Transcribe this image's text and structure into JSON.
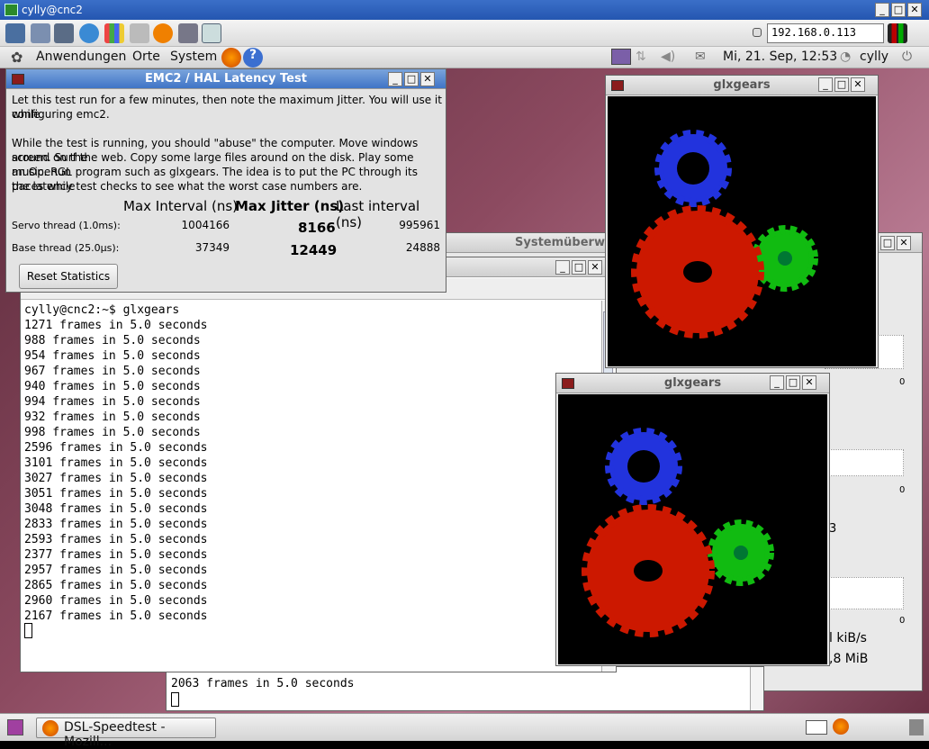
{
  "window": {
    "title": "cylly@cnc2"
  },
  "toolbar": {
    "ip": "192.168.0.113"
  },
  "panel": {
    "menu_apps": "Anwendungen",
    "menu_places": "Orte",
    "menu_system": "System",
    "clock": "Mi, 21. Sep, 12:53",
    "user": "cylly"
  },
  "emc": {
    "title": "EMC2 / HAL Latency Test",
    "intro1": "Let this test run for a few minutes, then note the maximum Jitter.  You will use it while",
    "intro2": "configuring emc2.",
    "body1": "While the test is running, you should \"abuse\" the computer. Move windows around on the",
    "body2": "screen. Surf the web. Copy some large files around on the disk. Play some music. Run",
    "body3": "an OpenGL program such as glxgears. The idea is to put the PC through its paces while",
    "body4": "the latency test checks to see what the worst case numbers are.",
    "col_max_interval": "Max Interval (ns)",
    "col_max_jitter": "Max Jitter (ns)",
    "col_last_interval": "Last interval (ns)",
    "servo_label": "Servo thread (1.0ms):",
    "servo_max_interval": "1004166",
    "servo_max_jitter": "8166",
    "servo_last_interval": "995961",
    "base_label": "Base thread (25.0µs):",
    "base_max_interval": "37349",
    "base_max_jitter": "12449",
    "base_last_interval": "24888",
    "reset_button": "Reset Statistics"
  },
  "sysmon": {
    "title": "Systemüberw",
    "rate": "l kiB/s",
    "mem": ",8 MiB",
    "axis_zero": "0",
    "partial_digit": "3"
  },
  "glx1": {
    "title": "glxgears"
  },
  "glx2": {
    "title": "glxgears"
  },
  "terminal": {
    "prompt": "cylly@cnc2:~$ glxgears",
    "lines": [
      "1271 frames in 5.0 seconds",
      "988 frames in 5.0 seconds",
      "954 frames in 5.0 seconds",
      "967 frames in 5.0 seconds",
      "940 frames in 5.0 seconds",
      "994 frames in 5.0 seconds",
      "932 frames in 5.0 seconds",
      "998 frames in 5.0 seconds",
      "2596 frames in 5.0 seconds",
      "3101 frames in 5.0 seconds",
      "3027 frames in 5.0 seconds",
      "3051 frames in 5.0 seconds",
      "3048 frames in 5.0 seconds",
      "2833 frames in 5.0 seconds",
      "2593 frames in 5.0 seconds",
      "2377 frames in 5.0 seconds",
      "2957 frames in 5.0 seconds",
      "2865 frames in 5.0 seconds",
      "2960 frames in 5.0 seconds",
      "2167 frames in 5.0 seconds"
    ]
  },
  "terminal2": {
    "line": "2063 frames in 5.0 seconds"
  },
  "taskbar": {
    "task_label": "DSL-Speedtest - Mozill..."
  }
}
